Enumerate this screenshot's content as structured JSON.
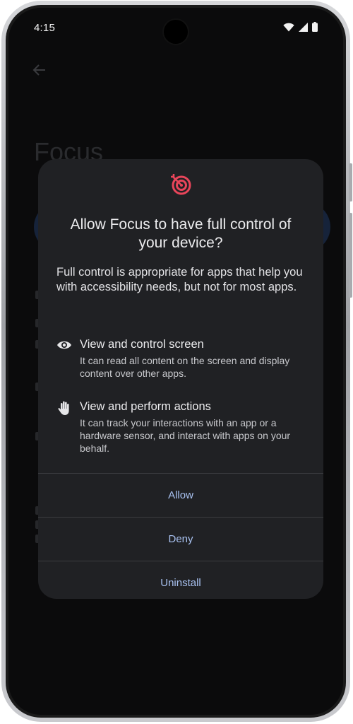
{
  "status_bar": {
    "time": "4:15",
    "icons": [
      "wifi-icon",
      "cellular-signal-icon",
      "battery-icon"
    ]
  },
  "background_app": {
    "title": "Focus",
    "back_icon": "arrow-back-icon"
  },
  "dialog": {
    "app_icon": "target-dartboard-icon",
    "title": "Allow Focus to have full control of your device?",
    "description": "Full control is appropriate for apps that help you with accessibility needs, but not for most apps.",
    "permissions": [
      {
        "icon": "eye-icon",
        "title": "View and control screen",
        "body": "It can read all content on the screen and display content over other apps."
      },
      {
        "icon": "hand-icon",
        "title": "View and perform actions",
        "body": "It can track your interactions with an app or a hardware sensor, and interact with apps on your behalf."
      }
    ],
    "actions": {
      "allow": "Allow",
      "deny": "Deny",
      "uninstall": "Uninstall"
    }
  },
  "colors": {
    "dialog_bg": "#202124",
    "action_text": "#a9c2f1",
    "accent_icon": "#e8455a"
  }
}
